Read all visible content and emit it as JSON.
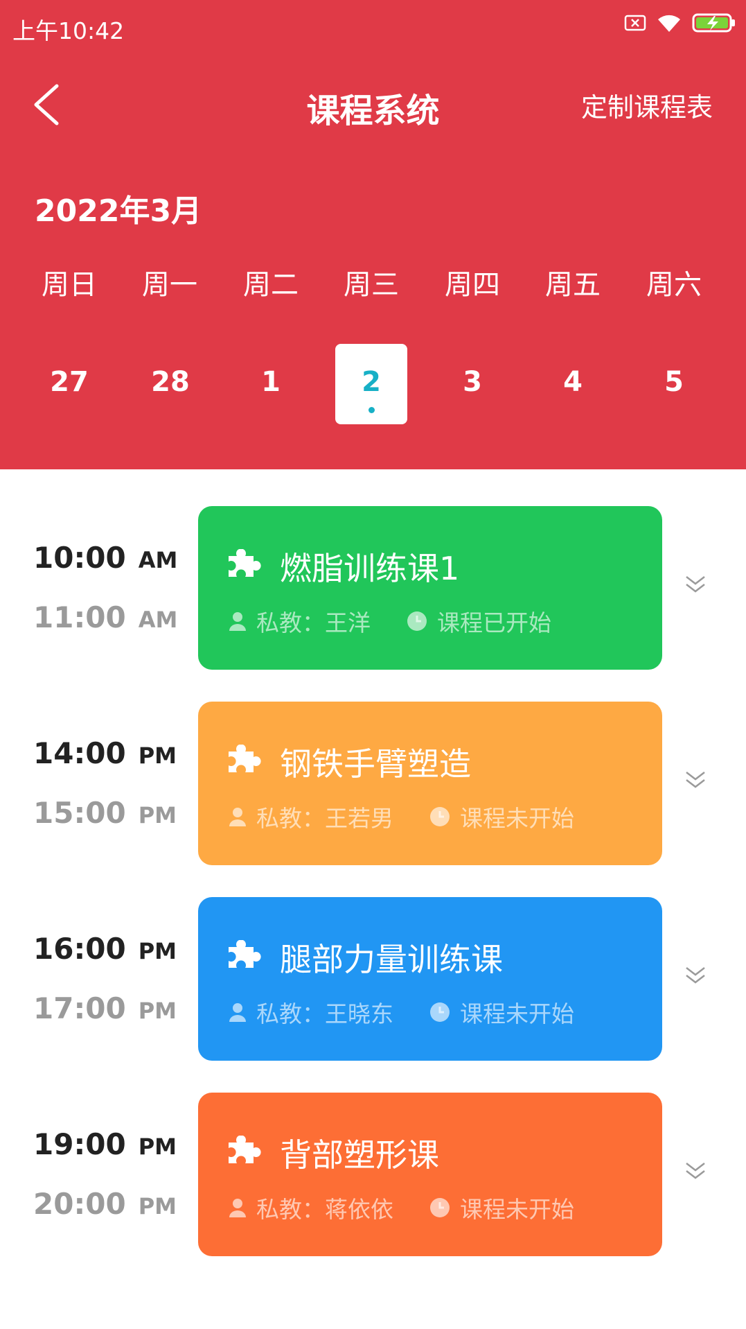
{
  "status_bar": {
    "time": "上午10:42"
  },
  "header": {
    "title": "课程系统",
    "action": "定制课程表",
    "month": "2022年3月"
  },
  "weekdays": [
    "周日",
    "周一",
    "周二",
    "周三",
    "周四",
    "周五",
    "周六"
  ],
  "dates": [
    "27",
    "28",
    "1",
    "2",
    "3",
    "4",
    "5"
  ],
  "selected_date": "2",
  "courses": [
    {
      "start": "10:00",
      "start_ampm": "AM",
      "end": "11:00",
      "end_ampm": "AM",
      "name": "燃脂训练课1",
      "coach": "私教：王洋",
      "status": "课程已开始",
      "color": "#21c65a"
    },
    {
      "start": "14:00",
      "start_ampm": "PM",
      "end": "15:00",
      "end_ampm": "PM",
      "name": "钢铁手臂塑造",
      "coach": "私教：王若男",
      "status": "课程未开始",
      "color": "#fea943"
    },
    {
      "start": "16:00",
      "start_ampm": "PM",
      "end": "17:00",
      "end_ampm": "PM",
      "name": "腿部力量训练课",
      "coach": "私教：王晓东",
      "status": "课程未开始",
      "color": "#2196f3"
    },
    {
      "start": "19:00",
      "start_ampm": "PM",
      "end": "20:00",
      "end_ampm": "PM",
      "name": "背部塑形课",
      "coach": "私教：蒋依依",
      "status": "课程未开始",
      "color": "#fd6e35"
    }
  ],
  "colors": {
    "header": "#e03a47",
    "selected_text": "#17b0c6"
  }
}
